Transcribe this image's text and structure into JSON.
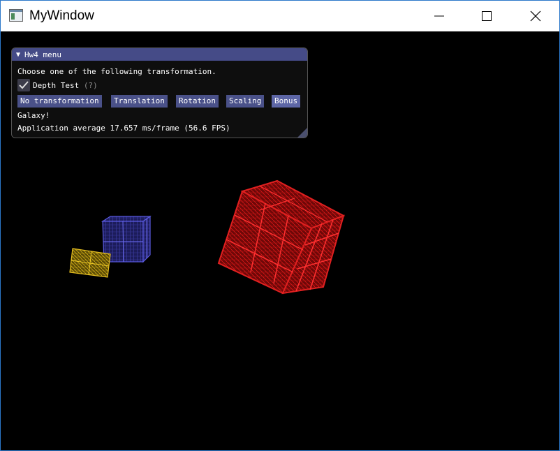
{
  "window": {
    "title": "MyWindow",
    "controls": [
      "minimize-icon",
      "maximize-icon",
      "close-icon"
    ]
  },
  "menu": {
    "title": "Hw4 menu",
    "instruction": "Choose one of the following transformation.",
    "depth_test": {
      "label": "Depth Test",
      "help": "(?)",
      "checked": true
    },
    "buttons": [
      {
        "label": "No transformation",
        "active": false
      },
      {
        "label": "Translation",
        "active": false
      },
      {
        "label": "Rotation",
        "active": false
      },
      {
        "label": "Scaling",
        "active": false
      },
      {
        "label": "Bonus",
        "active": true
      }
    ],
    "message": "Galaxy!",
    "fps": "Application average 17.657 ms/frame (56.6 FPS)"
  },
  "scene": {
    "objects": [
      {
        "name": "red-cube",
        "color": "#c81414"
      },
      {
        "name": "blue-cube",
        "color": "#3a3ab8"
      },
      {
        "name": "yellow-cube",
        "color": "#b89a10"
      }
    ]
  }
}
